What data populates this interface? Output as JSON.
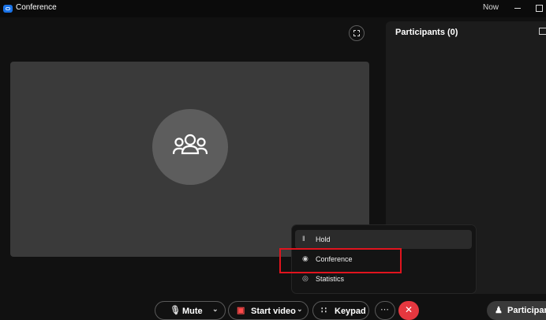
{
  "window": {
    "title": "Conference",
    "now_label": "Now"
  },
  "participants_panel": {
    "title": "Participants (0)"
  },
  "more_menu": {
    "items": [
      {
        "label": "Hold",
        "icon": "pause-icon"
      },
      {
        "label": "Conference",
        "icon": "conference-icon"
      },
      {
        "label": "Statistics",
        "icon": "statistics-icon"
      }
    ]
  },
  "toolbar": {
    "mute_label": "Mute",
    "start_video_label": "Start video",
    "keypad_label": "Keypad",
    "participants_label": "Participants"
  },
  "colors": {
    "hangup": "#e5373f",
    "highlight": "#e0141e",
    "video_off": "#ff4a4a"
  }
}
